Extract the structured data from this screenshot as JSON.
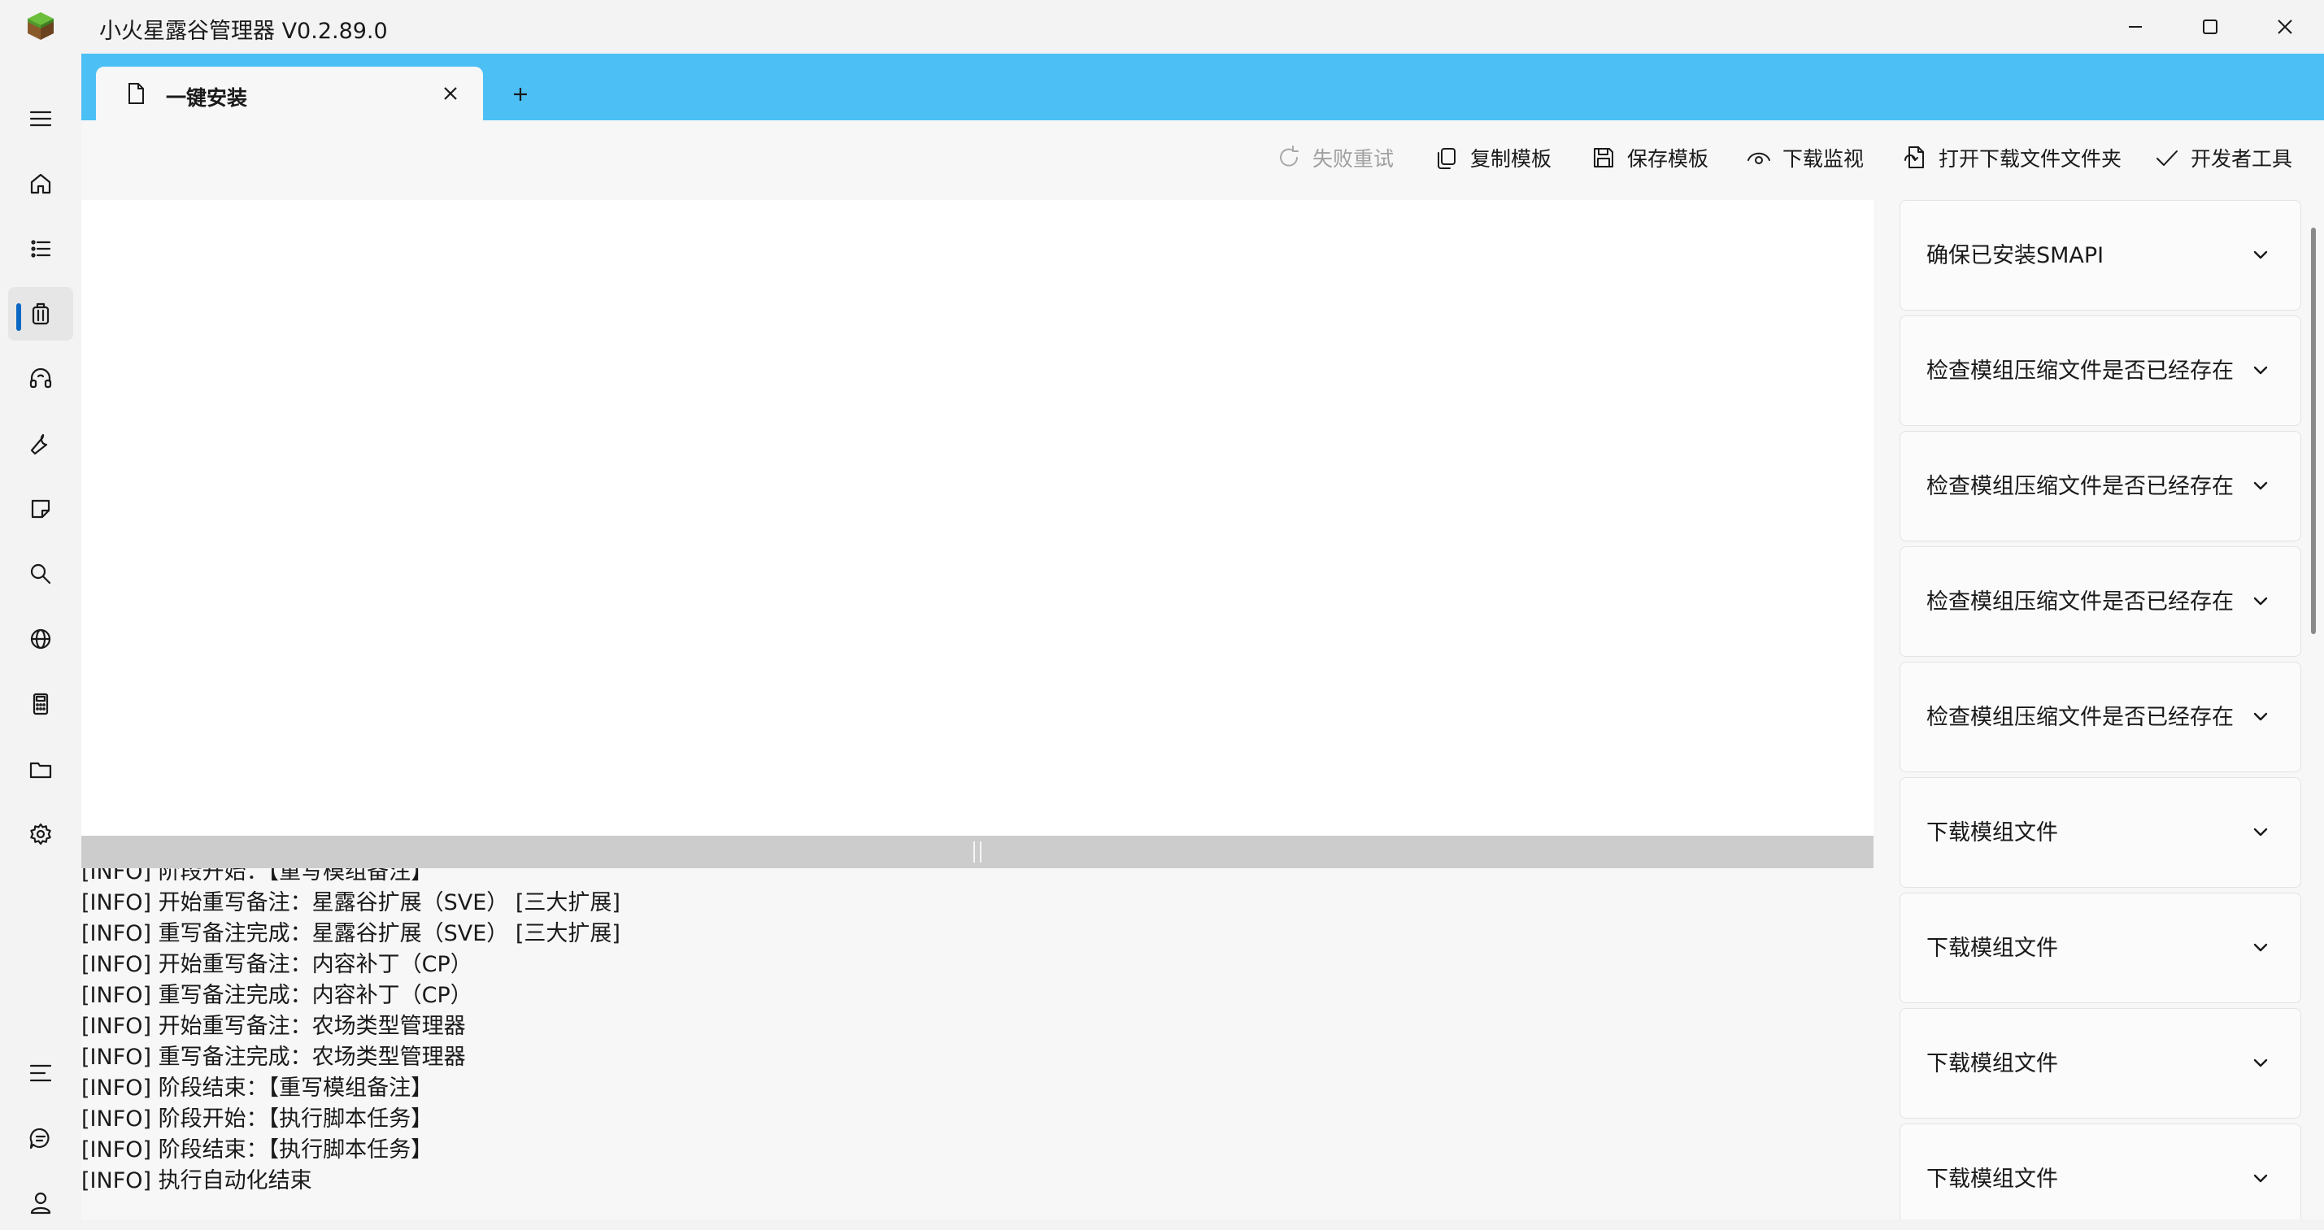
{
  "window": {
    "title": "小火星露谷管理器 V0.2.89.0",
    "logo_icon": "grass-block-icon",
    "controls": [
      "minimize-icon",
      "maximize-icon",
      "close-icon"
    ]
  },
  "sidebar": {
    "top_items": [
      {
        "id": "menu",
        "icon": "hamburger-menu-icon"
      },
      {
        "id": "home",
        "icon": "home-icon"
      },
      {
        "id": "list",
        "icon": "list-icon"
      },
      {
        "id": "install",
        "icon": "package-icon",
        "active": true
      },
      {
        "id": "audio",
        "icon": "headset-icon"
      },
      {
        "id": "tools",
        "icon": "wrench-icon"
      },
      {
        "id": "notes",
        "icon": "sticky-note-icon"
      },
      {
        "id": "search",
        "icon": "search-icon"
      },
      {
        "id": "web",
        "icon": "globe-icon"
      },
      {
        "id": "calculator",
        "icon": "calculator-icon"
      },
      {
        "id": "folder",
        "icon": "folder-icon"
      },
      {
        "id": "settings",
        "icon": "gear-icon"
      }
    ],
    "bottom_items": [
      {
        "id": "collapse",
        "icon": "collapse-list-icon"
      },
      {
        "id": "feedback",
        "icon": "chat-icon"
      },
      {
        "id": "account",
        "icon": "user-icon"
      }
    ],
    "accent_color": "#0b67c4"
  },
  "tabs": {
    "items": [
      {
        "label": "一键安装",
        "icon": "document-icon"
      }
    ],
    "bar_color": "#4cc0f5"
  },
  "toolbar": {
    "retry_label": "失败重试",
    "copy_template_label": "复制模板",
    "save_template_label": "保存模板",
    "download_monitor_label": "下载监视",
    "open_download_folder_label": "打开下载文件文件夹",
    "dev_tools_label": "开发者工具"
  },
  "log": {
    "lines": [
      "[INFO] 阶段开始：【重写模组备注】",
      "[INFO] 开始重写备注：星露谷扩展（SVE） [三大扩展]",
      "[INFO] 重写备注完成：星露谷扩展（SVE） [三大扩展]",
      "[INFO] 开始重写备注：内容补丁（CP）",
      "[INFO] 重写备注完成：内容补丁（CP）",
      "[INFO] 开始重写备注：农场类型管理器",
      "[INFO] 重写备注完成：农场类型管理器",
      "[INFO] 阶段结束：【重写模组备注】",
      "[INFO] 阶段开始：【执行脚本任务】",
      "[INFO] 阶段结束：【执行脚本任务】",
      "[INFO] 执行自动化结束"
    ]
  },
  "steps": [
    {
      "label": "确保已安装SMAPI"
    },
    {
      "label": "检查模组压缩文件是否已经存在"
    },
    {
      "label": "检查模组压缩文件是否已经存在"
    },
    {
      "label": "检查模组压缩文件是否已经存在"
    },
    {
      "label": "检查模组压缩文件是否已经存在"
    },
    {
      "label": "下载模组文件"
    },
    {
      "label": "下载模组文件"
    },
    {
      "label": "下载模组文件"
    },
    {
      "label": "下载模组文件"
    }
  ]
}
